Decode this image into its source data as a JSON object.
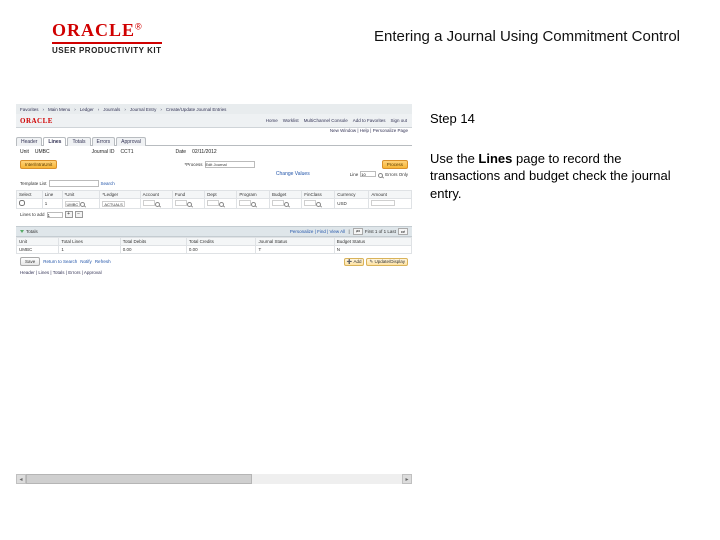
{
  "branding": {
    "word": "ORACLE",
    "reg": "®",
    "subtitle": "USER PRODUCTIVITY KIT"
  },
  "doc_title": "Entering a Journal Using Commitment Control",
  "step": {
    "heading": "Step 14",
    "pre": "Use the ",
    "bold": "Lines",
    "post": " page to record the transactions and budget check the journal entry."
  },
  "app": {
    "breadcrumb": [
      "Favorites",
      "Main Menu",
      "Ledger",
      "Journals",
      "Journal Entry",
      "Create/Update Journal Entries"
    ],
    "brand": "ORACLE",
    "top_links": [
      "Home",
      "Worklist",
      "MultiChannel Console",
      "Add to Favorites",
      "Sign out"
    ],
    "new_window": "New Window | Help | Personalize Page",
    "tabs": [
      "Header",
      "Lines",
      "Totals",
      "Errors",
      "Approval"
    ],
    "active_tab": 1,
    "header": {
      "unit_label": "Unit",
      "unit_value": "UMBC",
      "jid_label": "Journal ID",
      "jid_value": "CCT1",
      "date_label": "Date",
      "date_value": "02/11/2012"
    },
    "process": {
      "button": "Inter/IntraUnit",
      "process_label": "*Process",
      "process_value": "Edit Journal",
      "go": "Process",
      "change_values": "Change Values"
    },
    "template": {
      "label": "Template List",
      "search": "Search",
      "line_label": "Line",
      "line_value": "10",
      "errors_only": "Errors Only"
    },
    "grid1": {
      "cols": [
        "Select",
        "Line",
        "*Unit",
        "*Ledger",
        "Account",
        "Fund",
        "Dept",
        "Program",
        "Budget",
        "FinClass",
        "Currency",
        "Amount"
      ],
      "row": [
        "",
        "1",
        "UMBC",
        "ACTUALS",
        "",
        "",
        "",
        "",
        "",
        "",
        "USD",
        ""
      ]
    },
    "lines_add": {
      "label": "Lines to add",
      "value": "1"
    },
    "totals_title": "Totals",
    "totals_bar": {
      "pers": "Personalize | Find | View All",
      "nav": "First  1 of 1  Last"
    },
    "grid2": {
      "cols": [
        "Unit",
        "Total Lines",
        "Total Debits",
        "Total Credits",
        "Journal Status",
        "Budget Status"
      ],
      "row": [
        "UMBC",
        "1",
        "0.00",
        "0.00",
        "T",
        "N"
      ]
    },
    "actions": {
      "save": "Save",
      "ret": "Return to Search",
      "notify": "Notify",
      "refresh": "Refresh",
      "add": "Add",
      "upd": "Update/Display"
    },
    "footer": "Header | Lines | Totals | Errors | Approval"
  }
}
